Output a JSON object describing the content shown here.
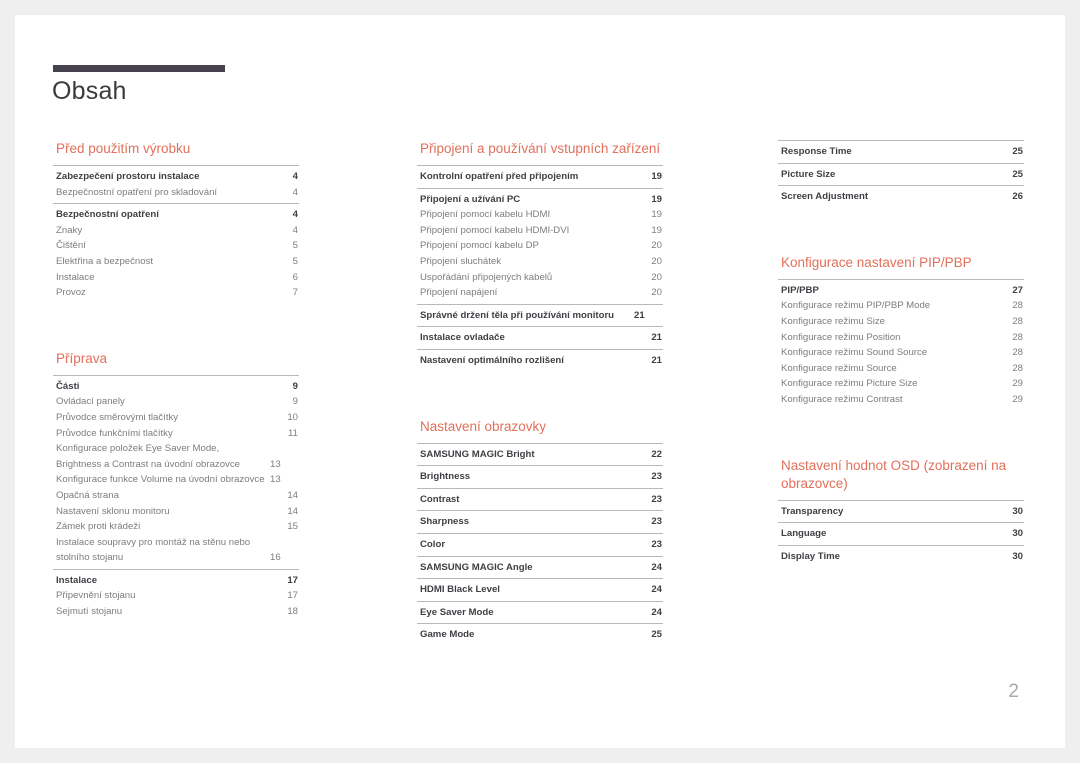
{
  "document": {
    "title": "Obsah",
    "page_number": "2",
    "accent_color": "#e2705a",
    "rule_color": "#45424e"
  },
  "columns": [
    {
      "sections": [
        {
          "heading": "Před použitím výrobku",
          "groups": [
            {
              "entries": [
                {
                  "label": "Zabezpečení prostoru instalace",
                  "page": "4",
                  "level": "main"
                },
                {
                  "label": "Bezpečnostní opatření pro skladování",
                  "page": "4",
                  "level": "sub"
                }
              ]
            },
            {
              "entries": [
                {
                  "label": "Bezpečnostní opatření",
                  "page": "4",
                  "level": "main"
                },
                {
                  "label": "Znaky",
                  "page": "4",
                  "level": "sub"
                },
                {
                  "label": "Čištění",
                  "page": "5",
                  "level": "sub"
                },
                {
                  "label": "Elektřina a bezpečnost",
                  "page": "5",
                  "level": "sub"
                },
                {
                  "label": "Instalace",
                  "page": "6",
                  "level": "sub"
                },
                {
                  "label": "Provoz",
                  "page": "7",
                  "level": "sub"
                }
              ]
            }
          ]
        },
        {
          "heading": "Příprava",
          "groups": [
            {
              "entries": [
                {
                  "label": "Části",
                  "page": "9",
                  "level": "main"
                },
                {
                  "label": "Ovládací panely",
                  "page": "9",
                  "level": "sub"
                },
                {
                  "label": "Průvodce směrovými tlačítky",
                  "page": "10",
                  "level": "sub"
                },
                {
                  "label": "Průvodce funkčními tlačítky",
                  "page": "11",
                  "level": "sub"
                },
                {
                  "label": "Konfigurace položek Eye Saver Mode, Brightness a Contrast na úvodní obrazovce",
                  "page": "13",
                  "level": "sub"
                },
                {
                  "label": "Konfigurace funkce Volume na úvodní obrazovce",
                  "page": "13",
                  "level": "sub"
                },
                {
                  "label": "Opačná strana",
                  "page": "14",
                  "level": "sub"
                },
                {
                  "label": "Nastavení sklonu monitoru",
                  "page": "14",
                  "level": "sub"
                },
                {
                  "label": "Zámek proti krádeži",
                  "page": "15",
                  "level": "sub"
                },
                {
                  "label": "Instalace soupravy pro montáž na stěnu nebo stolního stojanu",
                  "page": "16",
                  "level": "sub"
                }
              ]
            },
            {
              "entries": [
                {
                  "label": "Instalace",
                  "page": "17",
                  "level": "main"
                },
                {
                  "label": "Připevnění stojanu",
                  "page": "17",
                  "level": "sub"
                },
                {
                  "label": "Sejmutí stojanu",
                  "page": "18",
                  "level": "sub"
                }
              ]
            }
          ]
        }
      ]
    },
    {
      "sections": [
        {
          "heading": "Připojení a používání vstupních zařízení",
          "groups": [
            {
              "entries": [
                {
                  "label": "Kontrolní opatření před připojením",
                  "page": "19",
                  "level": "main"
                }
              ]
            },
            {
              "entries": [
                {
                  "label": "Připojení a užívání PC",
                  "page": "19",
                  "level": "main"
                },
                {
                  "label": "Připojení pomocí kabelu HDMI",
                  "page": "19",
                  "level": "sub"
                },
                {
                  "label": "Připojení pomocí kabelu HDMI-DVI",
                  "page": "19",
                  "level": "sub"
                },
                {
                  "label": "Připojení pomocí kabelu DP",
                  "page": "20",
                  "level": "sub"
                },
                {
                  "label": "Připojení sluchátek",
                  "page": "20",
                  "level": "sub"
                },
                {
                  "label": "Uspořádání připojených kabelů",
                  "page": "20",
                  "level": "sub"
                },
                {
                  "label": "Připojení napájení",
                  "page": "20",
                  "level": "sub"
                }
              ]
            },
            {
              "entries": [
                {
                  "label": "Správné držení těla při používání monitoru",
                  "page": "21",
                  "level": "main"
                }
              ]
            },
            {
              "entries": [
                {
                  "label": "Instalace ovladače",
                  "page": "21",
                  "level": "main"
                }
              ]
            },
            {
              "entries": [
                {
                  "label": "Nastavení optimálního rozlišení",
                  "page": "21",
                  "level": "main"
                }
              ]
            }
          ]
        },
        {
          "heading": "Nastavení obrazovky",
          "groups": [
            {
              "entries": [
                {
                  "label": "SAMSUNG MAGIC Bright",
                  "page": "22",
                  "level": "main"
                }
              ]
            },
            {
              "entries": [
                {
                  "label": "Brightness",
                  "page": "23",
                  "level": "main"
                }
              ]
            },
            {
              "entries": [
                {
                  "label": "Contrast",
                  "page": "23",
                  "level": "main"
                }
              ]
            },
            {
              "entries": [
                {
                  "label": "Sharpness",
                  "page": "23",
                  "level": "main"
                }
              ]
            },
            {
              "entries": [
                {
                  "label": "Color",
                  "page": "23",
                  "level": "main"
                }
              ]
            },
            {
              "entries": [
                {
                  "label": "SAMSUNG MAGIC Angle",
                  "page": "24",
                  "level": "main"
                }
              ]
            },
            {
              "entries": [
                {
                  "label": "HDMI Black Level",
                  "page": "24",
                  "level": "main"
                }
              ]
            },
            {
              "entries": [
                {
                  "label": "Eye Saver Mode",
                  "page": "24",
                  "level": "main"
                }
              ]
            },
            {
              "entries": [
                {
                  "label": "Game Mode",
                  "page": "25",
                  "level": "main"
                }
              ]
            }
          ]
        }
      ]
    },
    {
      "sections": [
        {
          "heading": "",
          "groups": [
            {
              "entries": [
                {
                  "label": "Response Time",
                  "page": "25",
                  "level": "main"
                }
              ]
            },
            {
              "entries": [
                {
                  "label": "Picture Size",
                  "page": "25",
                  "level": "main"
                }
              ]
            },
            {
              "entries": [
                {
                  "label": "Screen Adjustment",
                  "page": "26",
                  "level": "main"
                }
              ]
            }
          ]
        },
        {
          "heading": "Konfigurace nastavení PIP/PBP",
          "groups": [
            {
              "entries": [
                {
                  "label": "PIP/PBP",
                  "page": "27",
                  "level": "main"
                },
                {
                  "label": "Konfigurace režimu PIP/PBP Mode",
                  "page": "28",
                  "level": "sub"
                },
                {
                  "label": "Konfigurace režimu Size",
                  "page": "28",
                  "level": "sub"
                },
                {
                  "label": "Konfigurace režimu Position",
                  "page": "28",
                  "level": "sub"
                },
                {
                  "label": "Konfigurace režimu Sound Source",
                  "page": "28",
                  "level": "sub"
                },
                {
                  "label": "Konfigurace režimu Source",
                  "page": "28",
                  "level": "sub"
                },
                {
                  "label": "Konfigurace režimu Picture Size",
                  "page": "29",
                  "level": "sub"
                },
                {
                  "label": "Konfigurace režimu Contrast",
                  "page": "29",
                  "level": "sub"
                }
              ]
            }
          ]
        },
        {
          "heading": "Nastavení hodnot OSD (zobrazení na obrazovce)",
          "groups": [
            {
              "entries": [
                {
                  "label": "Transparency",
                  "page": "30",
                  "level": "main"
                }
              ]
            },
            {
              "entries": [
                {
                  "label": "Language",
                  "page": "30",
                  "level": "main"
                }
              ]
            },
            {
              "entries": [
                {
                  "label": "Display Time",
                  "page": "30",
                  "level": "main"
                }
              ]
            }
          ]
        }
      ]
    }
  ]
}
